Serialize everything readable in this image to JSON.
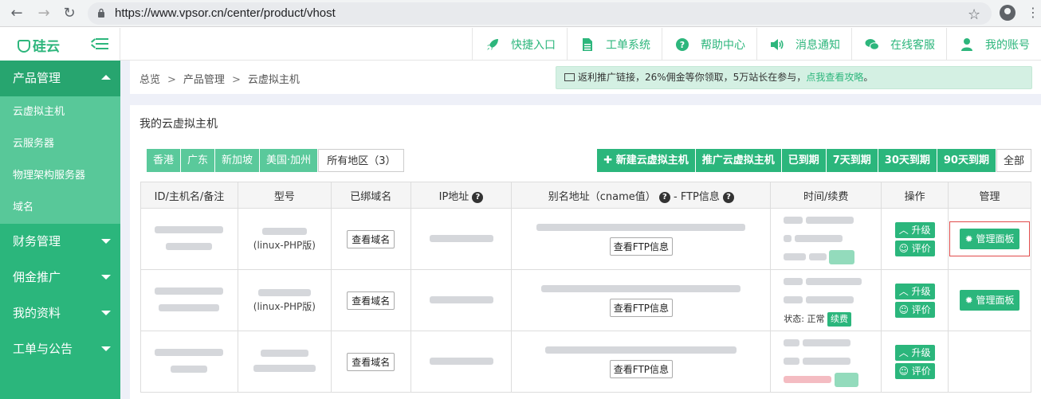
{
  "browser": {
    "url": "https://www.vpsor.cn/center/product/vhost"
  },
  "header": {
    "logo": "硅云",
    "nav": [
      {
        "label": "快捷入口",
        "icon": "rocket-icon"
      },
      {
        "label": "工单系统",
        "icon": "document-icon"
      },
      {
        "label": "帮助中心",
        "icon": "help-icon"
      },
      {
        "label": "消息通知",
        "icon": "speaker-icon"
      },
      {
        "label": "在线客服",
        "icon": "chat-icon"
      },
      {
        "label": "我的账号",
        "icon": "user-icon"
      }
    ]
  },
  "sidebar": {
    "groups": [
      {
        "label": "产品管理",
        "expanded": true
      },
      {
        "label": "财务管理"
      },
      {
        "label": "佣金推广"
      },
      {
        "label": "我的资料"
      },
      {
        "label": "工单与公告"
      }
    ],
    "sub_items": [
      "云虚拟主机",
      "云服务器",
      "物理架构服务器",
      "域名"
    ]
  },
  "breadcrumb": {
    "items": [
      "总览",
      "产品管理",
      "云虚拟主机"
    ],
    "sep": ">"
  },
  "promo": {
    "text": "返利推广链接，26%佣金等你领取，5万站长在参与，",
    "link": "点我查看攻略",
    "end": "。"
  },
  "panel": {
    "title": "我的云虚拟主机",
    "regions": [
      "香港",
      "广东",
      "新加坡",
      "美国·加州",
      "所有地区（3）"
    ],
    "actions": [
      "✚ 新建云虚拟主机",
      "推广云虚拟主机",
      "已到期",
      "7天到期",
      "30天到期",
      "90天到期",
      "全部"
    ]
  },
  "table": {
    "headers": [
      "ID/主机名/备注",
      "型号",
      "已绑域名",
      "IP地址",
      "别名地址（cname值）",
      "- FTP信息",
      "时间/续费",
      "操作",
      "管理"
    ],
    "model_suffix": "(linux-PHP版)",
    "view_domain": "查看域名",
    "view_ftp": "查看FTP信息",
    "upgrade": "升级",
    "review": "评价",
    "manage_panel": "管理面板",
    "status_label": "状态:",
    "status_value": "正常",
    "renew": "续费"
  }
}
